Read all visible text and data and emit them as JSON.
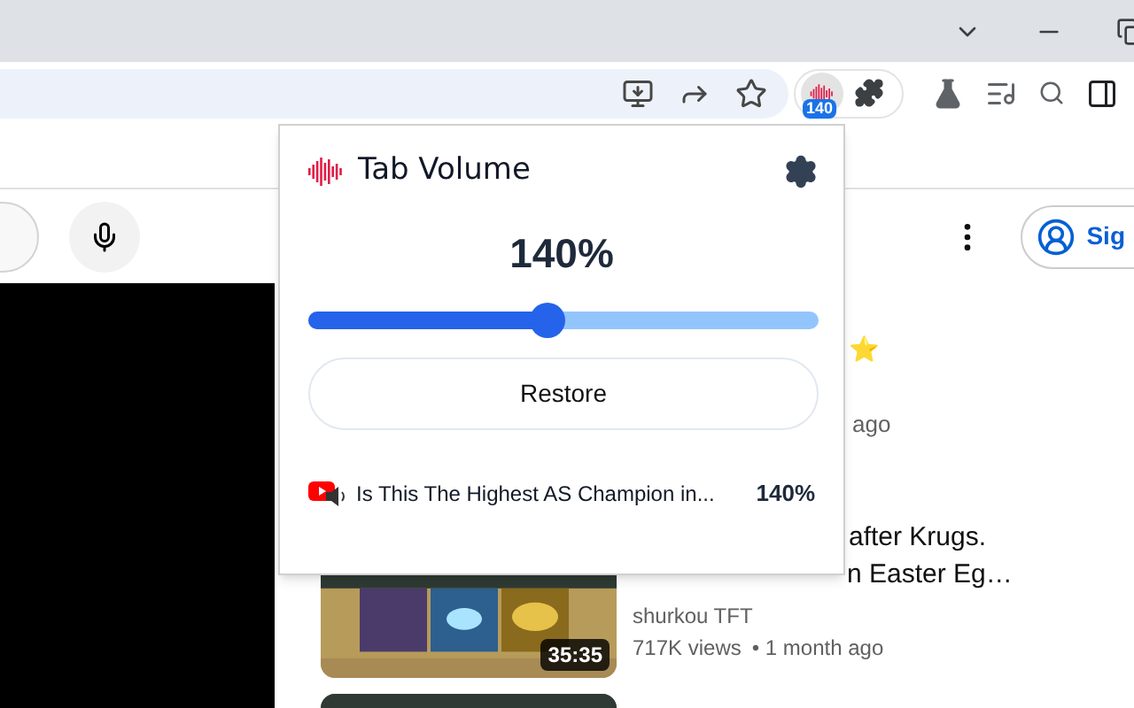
{
  "browser": {
    "extension_badge": "140"
  },
  "page": {
    "sign_in": "Sig",
    "videos": [
      {
        "title_lines": [
          "⭐"
        ],
        "meta": "ago"
      },
      {
        "title_lines": [
          "after Krugs.",
          "n Easter Eg…"
        ],
        "channel": "shurkou TFT",
        "views": "717K views",
        "age": "• 1 month ago",
        "duration": "35:35"
      },
      {
        "kind": "picture"
      }
    ]
  },
  "popup": {
    "title": "Tab Volume",
    "volume": "140%",
    "slider": {
      "level": 0.47
    },
    "restore_button": "Restore",
    "tabs": [
      {
        "title": "Is This The Highest AS Champion in...",
        "volume": "140%"
      }
    ]
  }
}
